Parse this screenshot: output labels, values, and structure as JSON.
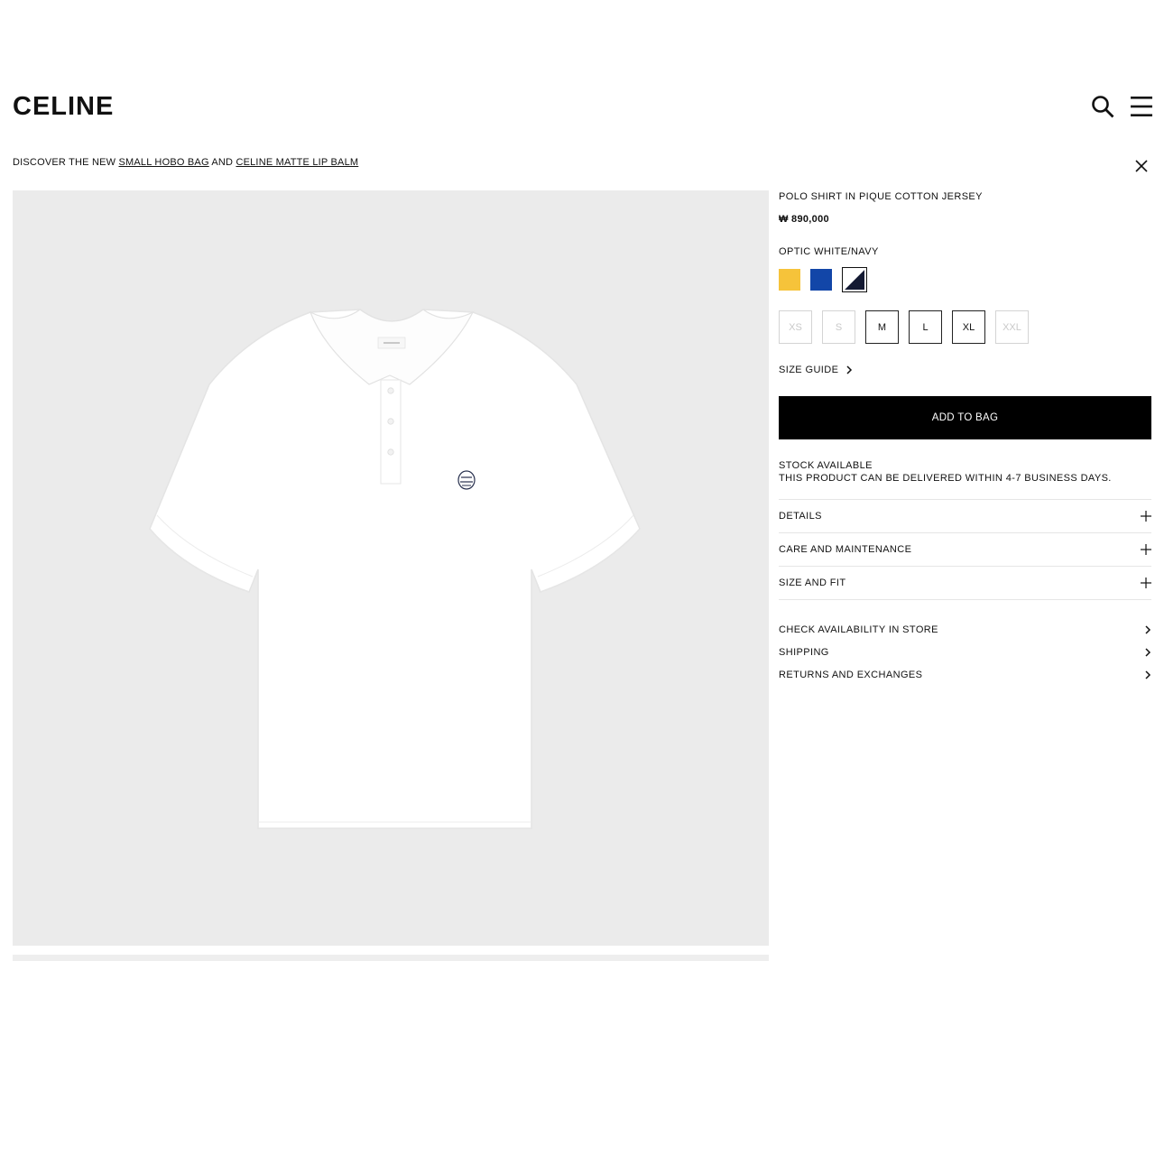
{
  "header": {
    "logo": "CELINE",
    "search_icon": "search-icon",
    "menu_icon": "hamburger-menu-icon"
  },
  "banner": {
    "prefix": "DISCOVER THE NEW ",
    "link1": "SMALL HOBO BAG",
    "middle": " AND ",
    "link2": "CELINE MATTE LIP BALM",
    "close_icon": "close-icon"
  },
  "product": {
    "name": "POLO SHIRT IN PIQUE COTTON JERSEY",
    "price": "₩ 890,000",
    "color_name": "OPTIC WHITE/NAVY",
    "swatches": [
      {
        "color": "#f6c33a",
        "name": "yellow"
      },
      {
        "color": "#1246a8",
        "name": "blue"
      },
      {
        "color": "optic-white-navy",
        "name": "optic-white-navy",
        "selected": true
      }
    ],
    "sizes": [
      {
        "label": "XS",
        "available": false
      },
      {
        "label": "S",
        "available": false
      },
      {
        "label": "M",
        "available": true
      },
      {
        "label": "L",
        "available": true
      },
      {
        "label": "XL",
        "available": true
      },
      {
        "label": "XXL",
        "available": false
      }
    ],
    "size_guide": "SIZE GUIDE",
    "add_to_bag": "ADD TO BAG",
    "stock_line1": "STOCK AVAILABLE",
    "stock_line2": "THIS PRODUCT CAN BE DELIVERED WITHIN 4-7 BUSINESS DAYS.",
    "accordion": [
      "DETAILS",
      "CARE AND MAINTENANCE",
      "SIZE AND FIT"
    ],
    "links": [
      "CHECK AVAILABILITY IN STORE",
      "SHIPPING",
      "RETURNS AND EXCHANGES"
    ]
  },
  "colors": {
    "image_bg": "#ebebeb",
    "button_bg": "#000000",
    "text": "#111111"
  }
}
